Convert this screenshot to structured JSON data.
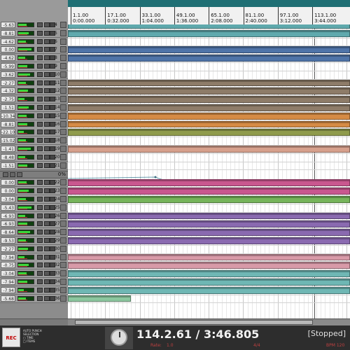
{
  "ruler": {
    "marks": [
      {
        "bar": "1.1.00",
        "time": "0:00.000"
      },
      {
        "bar": "17.1.00",
        "time": "0:32.000"
      },
      {
        "bar": "33.1.00",
        "time": "1:04.000"
      },
      {
        "bar": "49.1.00",
        "time": "1:36.000"
      },
      {
        "bar": "65.1.00",
        "time": "2:08.000"
      },
      {
        "bar": "81.1.00",
        "time": "2:40.000"
      },
      {
        "bar": "97.1.00",
        "time": "3:12.000"
      },
      {
        "bar": "113.1.00",
        "time": "3:44.000"
      }
    ]
  },
  "tracks_top": [
    {
      "vol": "-5.63",
      "num": "4"
    },
    {
      "vol": "-8.81",
      "num": "5"
    },
    {
      "vol": "-4.62",
      "num": "6"
    },
    {
      "vol": "0.00",
      "num": "7"
    },
    {
      "vol": "-4.62",
      "num": "8"
    },
    {
      "vol": "-5.99",
      "num": "9"
    },
    {
      "vol": "-3.62",
      "num": "10"
    },
    {
      "vol": "-2.27",
      "num": "11"
    },
    {
      "vol": "-4.32",
      "num": "12"
    },
    {
      "vol": "-2.75",
      "num": "13"
    },
    {
      "vol": "-1.51",
      "num": "14"
    },
    {
      "vol": "-10.34",
      "num": "15"
    },
    {
      "vol": "-8.81",
      "num": "16"
    },
    {
      "vol": "-22.10",
      "num": "17"
    },
    {
      "vol": "-15.02",
      "num": "18"
    },
    {
      "vol": "-1.41",
      "num": "19"
    },
    {
      "vol": "-8.48",
      "num": "20"
    },
    {
      "vol": "-1.51",
      "num": "21"
    }
  ],
  "master": {
    "pct": "0%"
  },
  "tracks_bottom": [
    {
      "vol": "0.00",
      "num": "22"
    },
    {
      "vol": "0.00",
      "num": "23"
    },
    {
      "vol": "-3.04",
      "num": "24"
    },
    {
      "vol": "-5.43",
      "num": "25"
    },
    {
      "vol": "-6.93",
      "num": "26"
    },
    {
      "vol": "-6.93",
      "num": "27"
    },
    {
      "vol": "-8.64",
      "num": "28"
    },
    {
      "vol": "-9.53",
      "num": "29"
    },
    {
      "vol": "-2.27",
      "num": "30"
    },
    {
      "vol": "-7.94",
      "num": "31"
    },
    {
      "vol": "-0.75",
      "num": "32"
    },
    {
      "vol": "-3.04",
      "num": "33"
    },
    {
      "vol": "-7.94",
      "num": "34"
    },
    {
      "vol": "-7.94",
      "num": "35"
    },
    {
      "vol": "-5.68",
      "num": "36"
    }
  ],
  "lane_colors": {
    "teal": "#5fa9ad",
    "blue": "#4f74a8",
    "brown": "#8e7c69",
    "orange": "#d58b45",
    "olive": "#8f9b4c",
    "salmon": "#d6a08c",
    "magenta": "#c9578f",
    "green": "#76b45b",
    "purple": "#8a6ab0",
    "pink": "#d89aa8",
    "lightteal": "#6fb7b4",
    "mint": "#8cc79f"
  },
  "transport": {
    "rec_label": "REC",
    "punch_lines": [
      "AUTO PUNCH",
      "SELECTION",
      "□ TIME",
      "□ ITEMS"
    ],
    "position": "114.2.61 / 3:46.805",
    "rate_label": "Rate:",
    "rate_value": "1.0",
    "time_sig": "4/4",
    "bpm_label": "BPM 120",
    "state": "[Stopped]"
  }
}
